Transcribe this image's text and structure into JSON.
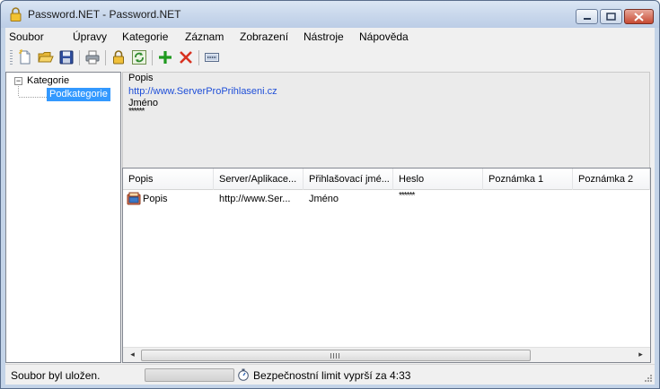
{
  "window": {
    "title": "Password.NET - Password.NET",
    "accent_color": "#c4d4e8"
  },
  "menu": {
    "items": [
      {
        "label": "Soubor"
      },
      {
        "label": "Úpravy"
      },
      {
        "label": "Kategorie"
      },
      {
        "label": "Záznam"
      },
      {
        "label": "Zobrazení"
      },
      {
        "label": "Nástroje"
      },
      {
        "label": "Nápověda"
      }
    ]
  },
  "toolbar": {
    "buttons": [
      {
        "icon": "new-document-icon"
      },
      {
        "icon": "open-folder-icon"
      },
      {
        "icon": "save-disk-icon"
      },
      {
        "icon": "print-icon"
      },
      {
        "icon": "lock-icon"
      },
      {
        "icon": "refresh-icon"
      },
      {
        "icon": "add-plus-icon"
      },
      {
        "icon": "delete-x-icon"
      },
      {
        "icon": "password-field-icon"
      }
    ]
  },
  "tree": {
    "root_label": "Kategorie",
    "child_label": "Podkategorie"
  },
  "detail": {
    "title": "Popis",
    "url": "http://www.ServerProPrihlaseni.cz",
    "username": "Jméno",
    "password": "******"
  },
  "list": {
    "columns": [
      {
        "label": "Popis"
      },
      {
        "label": "Server/Aplikace..."
      },
      {
        "label": "Přihlašovací jmé..."
      },
      {
        "label": "Heslo"
      },
      {
        "label": "Poznámka 1"
      },
      {
        "label": "Poznámka 2"
      }
    ],
    "rows": [
      {
        "popis": "Popis",
        "server": "http://www.Ser...",
        "login": "Jméno",
        "heslo": "******",
        "poznamka1": "",
        "poznamka2": ""
      }
    ]
  },
  "status": {
    "message": "Soubor byl uložen.",
    "timer_text": "Bezpečnostní limit vyprší za 4:33",
    "progress_fraction": 0
  }
}
